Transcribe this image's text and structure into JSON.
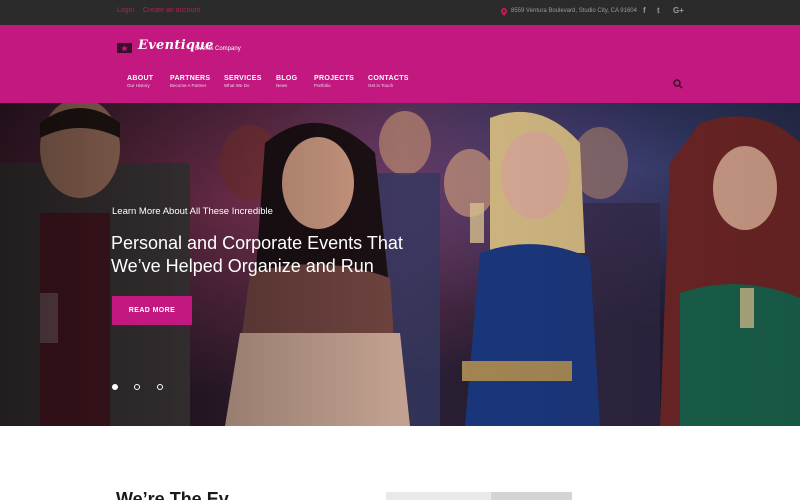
{
  "topbar": {
    "login": "Login",
    "create_account": "Create an account",
    "address": "8559 Ventura Boulevard, Studio City, CA 91604",
    "social": [
      {
        "icon": "facebook-icon",
        "glyph": "f"
      },
      {
        "icon": "twitter-icon",
        "glyph": "t"
      },
      {
        "icon": "google-plus-icon",
        "glyph": "G+"
      }
    ]
  },
  "brand": {
    "name": "Eventique",
    "tagline": "Events Company"
  },
  "nav": [
    {
      "label": "ABOUT",
      "sub": "Our History"
    },
    {
      "label": "PARTNERS",
      "sub": "Become A Partner"
    },
    {
      "label": "SERVICES",
      "sub": "What We Do"
    },
    {
      "label": "BLOG",
      "sub": "News"
    },
    {
      "label": "PROJECTS",
      "sub": "Portfolio"
    },
    {
      "label": "CONTACTS",
      "sub": "Get in Touch"
    }
  ],
  "hero": {
    "eyebrow": "Learn More About All These Incredible",
    "headline_line1": "Personal and Corporate Events That",
    "headline_line2": "We’ve Helped Organize and Run",
    "cta": "READ MORE",
    "slides_total": 3,
    "active_slide": 1
  },
  "section": {
    "title_partial": "We’re The Ev"
  },
  "colors": {
    "accent": "#c2187f",
    "topbar": "#2b2b2b",
    "link": "#c2185b"
  }
}
